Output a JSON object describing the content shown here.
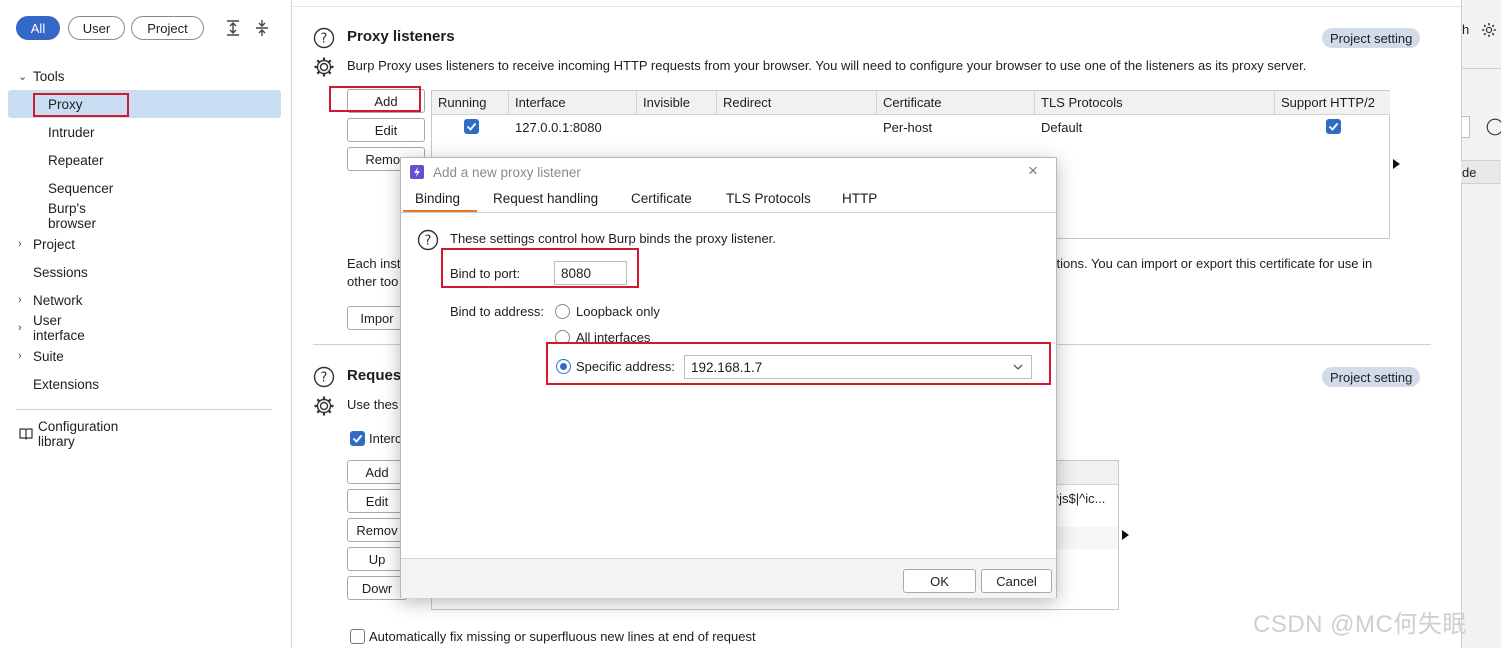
{
  "filters": {
    "all": "All",
    "user": "User",
    "project": "Project"
  },
  "sidebar": {
    "tools": "Tools",
    "tool_items": [
      "Proxy",
      "Intruder",
      "Repeater",
      "Sequencer",
      "Burp's browser"
    ],
    "project": "Project",
    "sessions": "Sessions",
    "network": "Network",
    "user_interface": "User interface",
    "suite": "Suite",
    "extensions": "Extensions",
    "config_library": "Configuration library"
  },
  "proxy_listeners": {
    "title": "Proxy listeners",
    "badge": "Project setting",
    "description": "Burp Proxy uses listeners to receive incoming HTTP requests from your browser. You will need to configure your browser to use one of the listeners as its proxy server.",
    "buttons": {
      "add": "Add",
      "edit": "Edit",
      "remove": "Remov"
    },
    "columns": [
      "Running",
      "Interface",
      "Invisible",
      "Redirect",
      "Certificate",
      "TLS Protocols",
      "Support HTTP/2"
    ],
    "rows": [
      {
        "running": true,
        "interface": "127.0.0.1:8080",
        "invisible": "",
        "redirect": "",
        "certificate": "Per-host",
        "tls": "Default",
        "http2": true
      }
    ],
    "cert_text_left_1": "Each inst",
    "cert_text_left_2": "other too",
    "cert_text_right": "ctions. You can import or export this certificate for use in",
    "import_button": "Impor"
  },
  "request_section": {
    "title_partial": "Reques",
    "badge": "Project setting",
    "desc_partial": "Use thes",
    "intercept_partial": "Interc",
    "buttons": {
      "add": "Add",
      "edit": "Edit",
      "remove": "Remov",
      "up": "Up",
      "down": "Dowr"
    },
    "rule_fragment": "^js$|^ic...",
    "auto_fix": "Automatically fix missing or superfluous new lines at end of request"
  },
  "right_strip": {
    "frag1": "h",
    "frag2": "de"
  },
  "dialog": {
    "title": "Add a new proxy listener",
    "tabs": [
      "Binding",
      "Request handling",
      "Certificate",
      "TLS Protocols",
      "HTTP"
    ],
    "info": "These settings control how Burp binds the proxy listener.",
    "port_label": "Bind to port:",
    "port_value": "8080",
    "address_label": "Bind to address:",
    "options": {
      "loopback": "Loopback only",
      "all": "All interfaces",
      "specific": "Specific address:"
    },
    "specific_value": "192.168.1.7",
    "ok": "OK",
    "cancel": "Cancel"
  },
  "watermark": "CSDN @MC何失眠",
  "colors": {
    "accent": "#2f6cc2",
    "highlight": "#d3192b",
    "selection": "#c9ddf3",
    "tab_underline": "#e8782a"
  }
}
